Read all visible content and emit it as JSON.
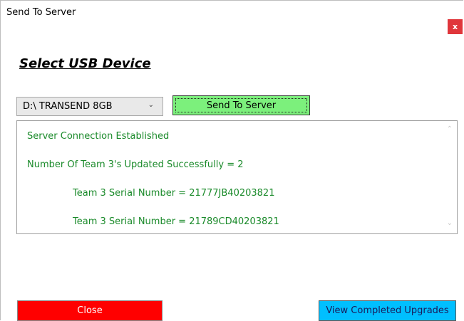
{
  "window": {
    "title": "Send To Server",
    "close_glyph": "x"
  },
  "main": {
    "heading": "Select USB Device",
    "device_select": {
      "selected": "D:\\ TRANSEND 8GB",
      "icon": "chevron-down-icon"
    },
    "send_button_label": "Send To Server",
    "log": [
      "Server Connection Established",
      "Number Of Team 3's Updated Successfully = 2",
      "Team 3 Serial Number = 21777JB40203821",
      "Team 3 Serial Number = 21789CD40203821"
    ]
  },
  "footer": {
    "close_label": "Close",
    "view_label": "View Completed Upgrades"
  },
  "colors": {
    "send_button": "#7cf07c",
    "close_button": "#ff0000",
    "view_button": "#00bfff",
    "log_text": "#1a8a2a",
    "title_close": "#e0363b"
  }
}
